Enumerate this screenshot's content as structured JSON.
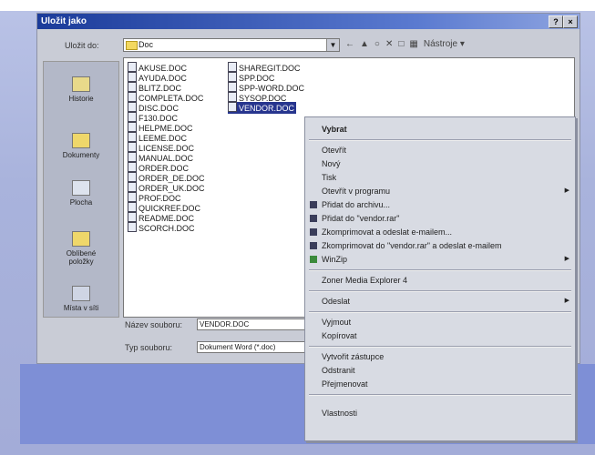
{
  "dialog": {
    "title": "Uložit jako",
    "help_btn": "?",
    "close_btn": "×",
    "save_in_label": "Uložit do:",
    "folder": "Doc",
    "tools_label": "Nástroje",
    "filename_label": "Název souboru:",
    "filename_value": "VENDOR.DOC",
    "filetype_label": "Typ souboru:",
    "filetype_value": "Dokument Word (*.doc)"
  },
  "places": [
    "Historie",
    "Dokumenty",
    "Plocha",
    "Oblíbené položky",
    "Místa v síti"
  ],
  "files_col1": [
    "AKUSE.DOC",
    "AYUDA.DOC",
    "BLITZ.DOC",
    "COMPLETA.DOC",
    "DISC.DOC",
    "F130.DOC",
    "HELPME.DOC",
    "LEEME.DOC",
    "LICENSE.DOC",
    "MANUAL.DOC",
    "ORDER.DOC",
    "ORDER_DE.DOC",
    "ORDER_UK.DOC",
    "PROF.DOC",
    "QUICKREF.DOC",
    "README.DOC",
    "SCORCH.DOC"
  ],
  "files_col2": [
    "SHAREGIT.DOC",
    "SPP.DOC",
    "SPP-WORD.DOC",
    "SYSOP.DOC",
    "VENDOR.DOC"
  ],
  "context_menu": {
    "items": [
      {
        "label": "Vybrat",
        "bold": true
      },
      {
        "label": "Otevřít"
      },
      {
        "label": "Nový"
      },
      {
        "label": "Tisk"
      },
      {
        "label": "Otevřít v programu",
        "sub": true
      },
      {
        "label": "Přidat do archivu...",
        "icon": true
      },
      {
        "label": "Přidat do \"vendor.rar\"",
        "icon": true
      },
      {
        "label": "Zkomprimovat a odeslat e-mailem...",
        "icon": true
      },
      {
        "label": "Zkomprimovat do \"vendor.rar\" a odeslat e-mailem",
        "icon": true
      },
      {
        "label": "WinZip",
        "icon": true,
        "sub": true
      },
      {
        "label": "Zoner Media Explorer 4"
      },
      {
        "label": "Odeslat",
        "sub": true
      },
      {
        "label": "Vyjmout"
      },
      {
        "label": "Kopírovat"
      },
      {
        "label": "Vytvořit zástupce"
      },
      {
        "label": "Odstranit"
      },
      {
        "label": "Přejmenovat"
      },
      {
        "label": "Vlastnosti"
      }
    ]
  }
}
